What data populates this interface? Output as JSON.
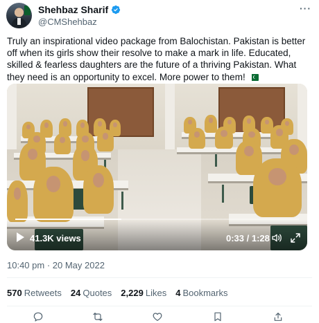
{
  "author": {
    "name": "Shehbaz Sharif",
    "handle": "@CMShehbaz",
    "verified_icon": "verified-badge-icon"
  },
  "menu": {
    "more_label": "···"
  },
  "tweet": {
    "text": "Truly an inspirational video package from Balochistan. Pakistan is better off when its girls show their resolve to make a mark in life. Educated, skilled & fearless daughters are the future of a thriving Pakistan. What they need is an opportunity to excel. More power to them!"
  },
  "video": {
    "views": "41.3K views",
    "time": "0:33 / 1:28",
    "progress": 0.375
  },
  "timestamp": "10:40 pm · 20 May 2022",
  "stats": {
    "retweets_count": "570",
    "retweets_label": "Retweets",
    "quotes_count": "24",
    "quotes_label": "Quotes",
    "likes_count": "2,229",
    "likes_label": "Likes",
    "bookmarks_count": "4",
    "bookmarks_label": "Bookmarks"
  },
  "colors": {
    "text": "#0f1419",
    "secondary": "#536471",
    "verified": "#1d9bf0"
  }
}
